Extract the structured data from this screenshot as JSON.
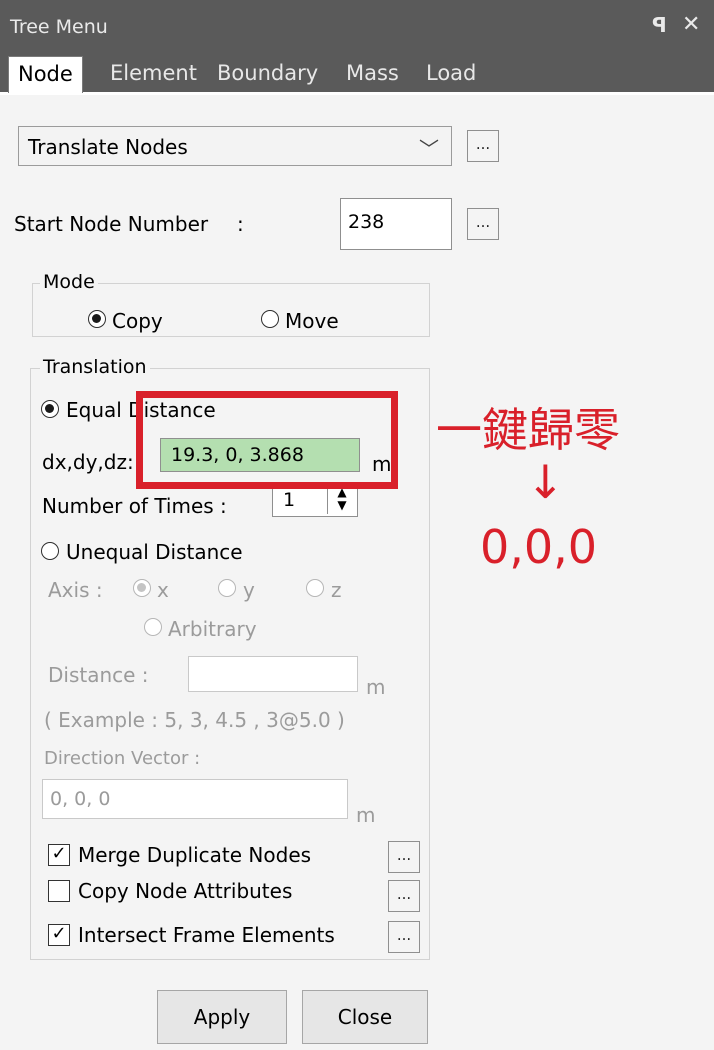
{
  "window": {
    "title": "Tree Menu",
    "pin_icon": "pin-icon",
    "close_icon": "close-icon"
  },
  "tabs": [
    "Node",
    "Element",
    "Boundary",
    "Mass",
    "Load"
  ],
  "active_tab": "Node",
  "function_select": {
    "value": "Translate Nodes",
    "more": "..."
  },
  "start_node": {
    "label": "Start Node Number",
    "colon": ":",
    "value": "238",
    "more": "..."
  },
  "mode": {
    "title": "Mode",
    "options": [
      "Copy",
      "Move"
    ],
    "selected": "Copy"
  },
  "translation": {
    "title": "Translation",
    "equal_label": "Equal Distance",
    "dxdydz_label": "dx,dy,dz:",
    "dxdydz_value": "19.3, 0, 3.868",
    "dxdydz_unit": "m",
    "number_of_times_label": "Number of Times :",
    "number_of_times_value": "1",
    "unequal_label": "Unequal Distance",
    "axis_label": "Axis :",
    "axis_options": [
      "x",
      "y",
      "z"
    ],
    "arbitrary_label": "Arbitrary",
    "distance_label": "Distance :",
    "distance_unit": "m",
    "example_text": "( Example :  5, 3, 4.5 , 3@5.0 )",
    "direction_label": "Direction Vector :",
    "direction_value": "0, 0, 0",
    "direction_unit": "m"
  },
  "options": [
    {
      "label": "Merge Duplicate Nodes",
      "checked": true,
      "more": "..."
    },
    {
      "label": "Copy Node Attributes",
      "checked": false,
      "more": "..."
    },
    {
      "label": "Intersect Frame Elements",
      "checked": true,
      "more": "..."
    }
  ],
  "buttons": {
    "apply": "Apply",
    "close": "Close"
  },
  "annotation": {
    "text": "一鍵歸零",
    "arrow": "↓",
    "result": "0,0,0",
    "color": "#d9202a"
  }
}
